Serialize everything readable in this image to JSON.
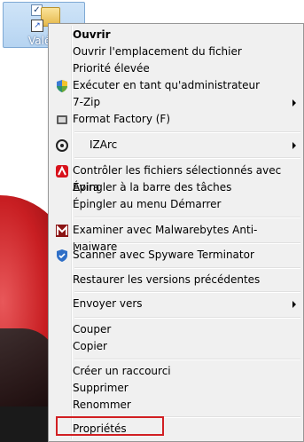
{
  "desktop_icon": {
    "label": "Valér"
  },
  "menu": {
    "items": [
      {
        "label": "Ouvrir"
      },
      {
        "label": "Ouvrir l'emplacement du fichier"
      },
      {
        "label": "Priorité élevée"
      },
      {
        "label": "Exécuter en tant qu'administrateur"
      },
      {
        "label": "7-Zip"
      },
      {
        "label": "Format Factory (F)"
      },
      {
        "label": "IZArc"
      },
      {
        "label": "Contrôler les fichiers sélectionnés avec Avira"
      },
      {
        "label": "Épingler à la barre des tâches"
      },
      {
        "label": "Épingler au menu Démarrer"
      },
      {
        "label": "Examiner avec Malwarebytes Anti-Malware"
      },
      {
        "label": "Scanner avec Spyware Terminator"
      },
      {
        "label": "Restaurer les versions précédentes"
      },
      {
        "label": "Envoyer vers"
      },
      {
        "label": "Couper"
      },
      {
        "label": "Copier"
      },
      {
        "label": "Créer un raccourci"
      },
      {
        "label": "Supprimer"
      },
      {
        "label": "Renommer"
      },
      {
        "label": "Propriétés"
      }
    ]
  },
  "colors": {
    "highlight": "#d11f22",
    "menu_bg": "#f0f0f0"
  }
}
